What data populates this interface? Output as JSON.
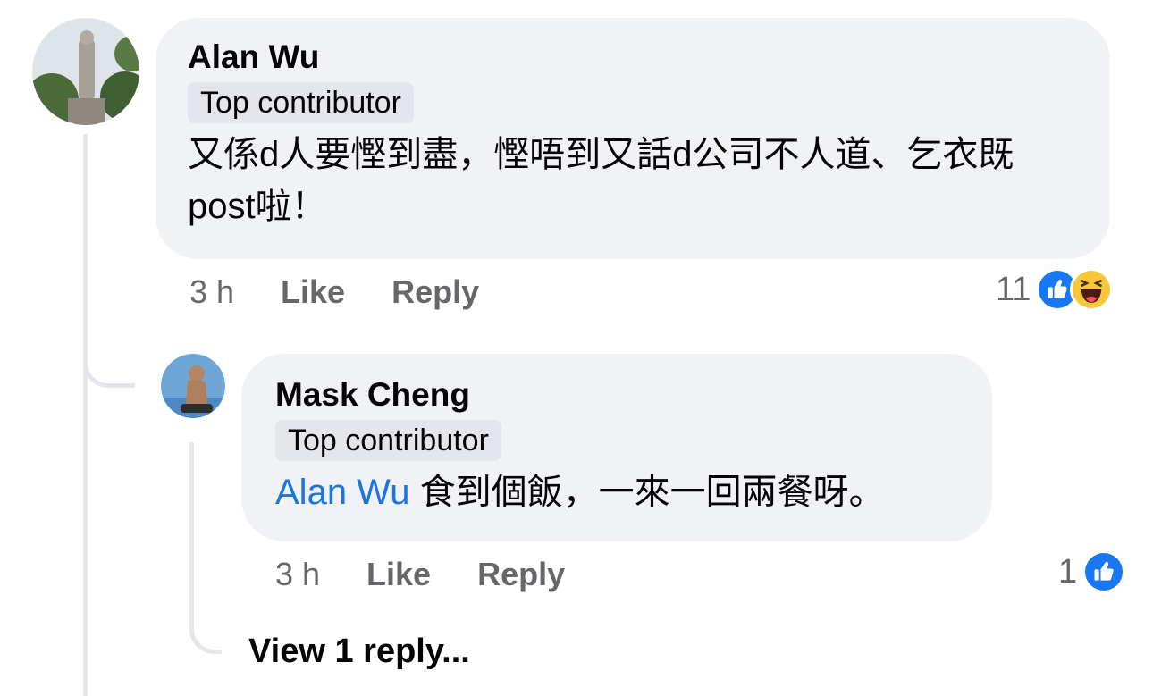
{
  "comment": {
    "author": "Alan Wu",
    "badge": "Top contributor",
    "text": "又係d人要慳到盡，慳唔到又話d公司不人道、乞衣既post啦！",
    "time": "3 h",
    "like_label": "Like",
    "reply_label": "Reply",
    "reaction_count": "11",
    "reactions": [
      "like-icon",
      "haha-icon"
    ]
  },
  "reply": {
    "author": "Mask Cheng",
    "badge": "Top contributor",
    "mention": "Alan Wu",
    "text": " 食到個飯，一來一回兩餐呀。",
    "time": "3 h",
    "like_label": "Like",
    "reply_label": "Reply",
    "reaction_count": "1",
    "reactions": [
      "like-icon"
    ]
  },
  "view_replies_label": "View 1 reply...",
  "colors": {
    "bubble": "#f0f2f5",
    "badge": "#e4e6eb",
    "mention": "#1b74e4",
    "secondary_text": "#65676b",
    "like_blue": "#1877f2",
    "haha_yellow": "#f7c73b"
  }
}
